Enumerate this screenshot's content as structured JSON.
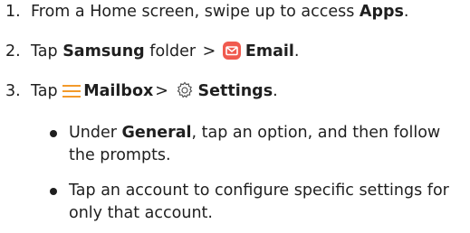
{
  "steps": [
    {
      "number": "1.",
      "pre": "From a Home screen, swipe up to access ",
      "bold": "Apps",
      "post": "."
    },
    {
      "number": "2.",
      "pre": "Tap ",
      "bold1": "Samsung",
      "mid": " folder ",
      "sep": ">",
      "bold2": "Email",
      "post": ".",
      "email_icon": "email-app-icon",
      "email_icon_color": "#f05a4f"
    },
    {
      "number": "3.",
      "pre": "Tap ",
      "bold1": "Mailbox",
      "sep": ">",
      "bold2": "Settings",
      "post": ".",
      "menu_icon": "menu-lines-icon",
      "menu_icon_color": "#f39a2b",
      "settings_icon": "gear-icon"
    }
  ],
  "bullets": [
    {
      "pre": "Under ",
      "bold": "General",
      "line1_rest": ", tap an option, and then follow",
      "line2": "the prompts."
    },
    {
      "line1": "Tap an account to configure specific settings for",
      "line2": "only that account."
    }
  ]
}
